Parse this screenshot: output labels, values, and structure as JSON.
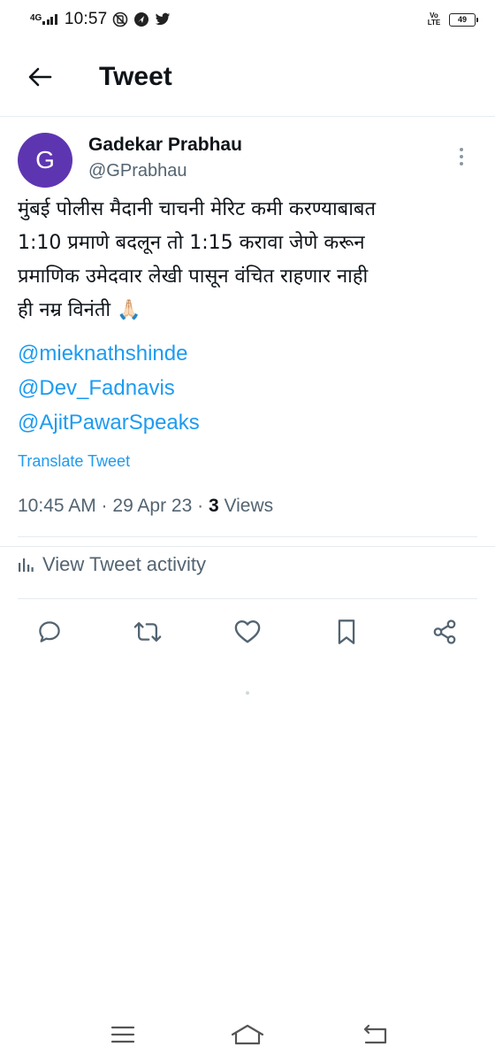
{
  "status_bar": {
    "network": "4G",
    "time": "10:57",
    "volte": "Vo LTE",
    "battery": "49"
  },
  "header": {
    "title": "Tweet"
  },
  "tweet": {
    "avatar_initial": "G",
    "author_name": "Gadekar Prabhau",
    "author_handle": "@GPrabhau",
    "body_lines": [
      "मुंबई पोलीस मैदानी चाचनी मेरिट कमी करण्याबाबत",
      "1:10 प्रमाणे बदलून तो 1:15 करावा जेणे करून",
      "प्रमाणिक उमेदवार लेखी पासून वंचित राहणार नाही",
      "ही नम्र विनंती 🙏🏻"
    ],
    "mentions": [
      "@mieknathshinde",
      "@Dev_Fadnavis",
      "@AjitPawarSpeaks"
    ],
    "translate_label": "Translate Tweet",
    "timestamp": "10:45 AM · 29 Apr 23 · ",
    "views_count": "3",
    "views_label": " Views",
    "activity_label": "View Tweet activity"
  },
  "icons": {
    "back": "arrow-left-icon",
    "more": "more-vertical-icon",
    "activity": "analytics-bars-icon",
    "reply": "reply-icon",
    "retweet": "retweet-icon",
    "like": "heart-icon",
    "bookmark": "bookmark-icon",
    "share": "share-icon",
    "nav_menu": "menu-icon",
    "nav_home": "home-icon",
    "nav_back": "back-icon"
  },
  "colors": {
    "link": "#1d9bf0",
    "secondary_text": "#536471",
    "avatar_bg": "#5e35b1"
  }
}
